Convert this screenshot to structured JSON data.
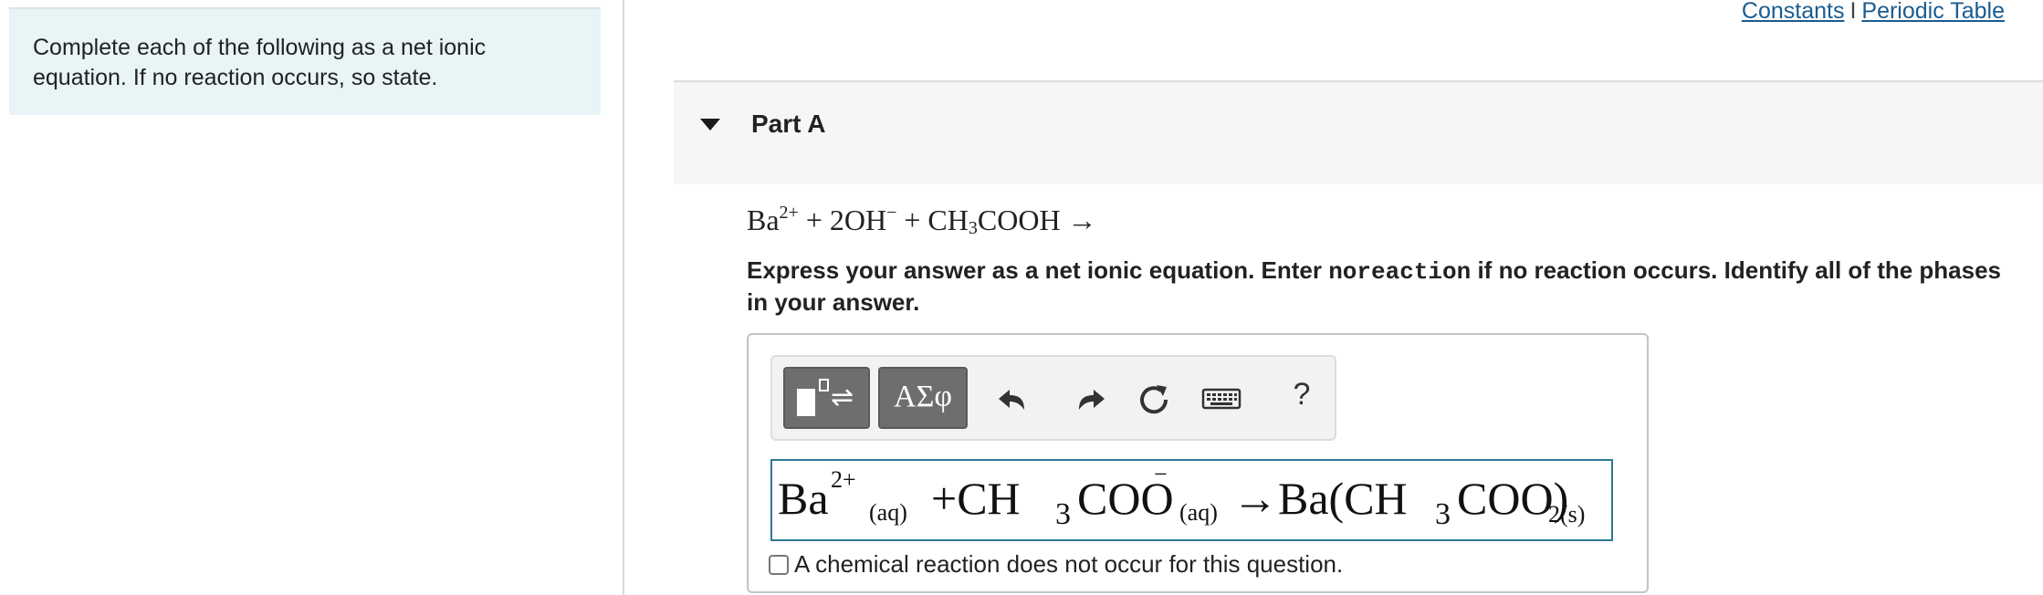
{
  "intro": {
    "text_line1": "Complete each of the following as a net ionic",
    "text_line2": "equation. If no reaction occurs, so state."
  },
  "links": {
    "constants": "Constants",
    "separator": "I",
    "periodic_table": "Periodic Table"
  },
  "part": {
    "title": "Part A"
  },
  "question": {
    "eq_ba": "Ba",
    "eq_ba_charge": "2+",
    "eq_plus1": " + 2OH",
    "eq_oh_charge": "−",
    "eq_plus2": " + CH",
    "eq_ch3_sub": "3",
    "eq_cooh": "COOH →"
  },
  "instructions": {
    "part1": "Express your answer as a net ionic equation. Enter ",
    "code": "noreaction",
    "part2": " if no reaction occurs. Identify all of the phases in your answer."
  },
  "toolbar": {
    "templates_arrows": "⇌",
    "symbols_label": "ΑΣφ",
    "help_label": "?"
  },
  "answer": {
    "ba": "Ba",
    "ba_charge": "2+",
    "aq1": "(aq)",
    "plus_ch": "+CH",
    "sub3a": "3",
    "coo": "COO",
    "minus": "−",
    "aq2": "(aq)",
    "arrow_ba": "→Ba(CH",
    "sub3b": "3",
    "coo_paren": "COO)",
    "sub_2s": "2(s)"
  },
  "no_reaction": {
    "label": "A chemical reaction does not occur for this question."
  },
  "colors": {
    "link": "#1b5c8f",
    "intro_bg": "#e8f4f6",
    "input_border": "#2c7a95",
    "tool_button": "#6e6e6e"
  }
}
